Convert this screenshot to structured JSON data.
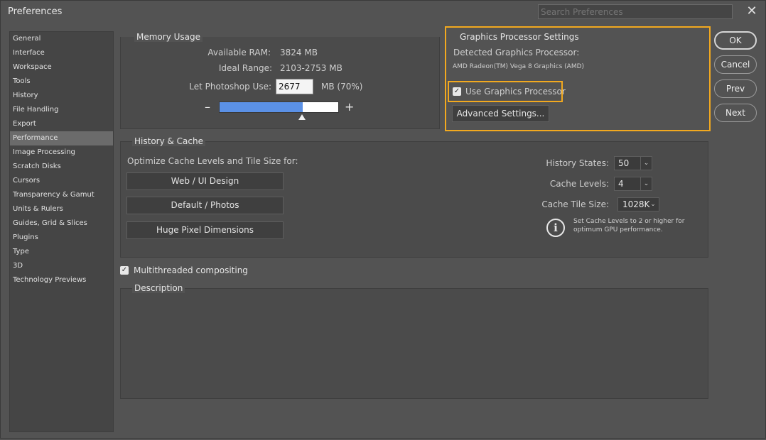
{
  "window": {
    "title": "Preferences",
    "search_placeholder": "Search Preferences",
    "close_glyph": "✕"
  },
  "sidebar": {
    "items": [
      {
        "label": "General"
      },
      {
        "label": "Interface"
      },
      {
        "label": "Workspace"
      },
      {
        "label": "Tools"
      },
      {
        "label": "History"
      },
      {
        "label": "File Handling"
      },
      {
        "label": "Export"
      },
      {
        "label": "Performance"
      },
      {
        "label": "Image Processing"
      },
      {
        "label": "Scratch Disks"
      },
      {
        "label": "Cursors"
      },
      {
        "label": "Transparency & Gamut"
      },
      {
        "label": "Units & Rulers"
      },
      {
        "label": "Guides, Grid & Slices"
      },
      {
        "label": "Plugins"
      },
      {
        "label": "Type"
      },
      {
        "label": "3D"
      },
      {
        "label": "Technology Previews"
      }
    ],
    "selected": "Performance"
  },
  "memory": {
    "title": "Memory Usage",
    "available_label": "Available RAM:",
    "available_value": "3824 MB",
    "ideal_label": "Ideal Range:",
    "ideal_value": "2103-2753 MB",
    "use_label": "Let Photoshop Use:",
    "use_value": "2677",
    "use_unit": "MB (70%)",
    "slider_fraction": 0.7,
    "minus": "–",
    "plus": "+"
  },
  "gpu": {
    "title": "Graphics Processor Settings",
    "detected_label": "Detected Graphics Processor:",
    "detected_value": "AMD Radeon(TM) Vega 8 Graphics (AMD)",
    "use_gpu_label": "Use Graphics Processor",
    "use_gpu_checked": true,
    "advanced_label": "Advanced Settings..."
  },
  "history_cache": {
    "title": "History & Cache",
    "optimize_label": "Optimize Cache Levels and Tile Size for:",
    "buttons": [
      "Web / UI Design",
      "Default / Photos",
      "Huge Pixel Dimensions"
    ],
    "history_states_label": "History States:",
    "history_states_value": "50",
    "cache_levels_label": "Cache Levels:",
    "cache_levels_value": "4",
    "tile_size_label": "Cache Tile Size:",
    "tile_size_value": "1028K",
    "info_text_1": "Set Cache Levels to 2 or higher for",
    "info_text_2": "optimum GPU performance."
  },
  "options": {
    "multithreaded_label": "Multithreaded compositing",
    "multithreaded_checked": true
  },
  "description": {
    "title": "Description"
  },
  "actions": {
    "ok": "OK",
    "cancel": "Cancel",
    "prev": "Prev",
    "next": "Next"
  },
  "colors": {
    "highlight": "#f2a91f",
    "slider_fill": "#5b91e6",
    "background": "#535353"
  },
  "icons": {
    "checkmark": "check-icon",
    "info": "info-icon",
    "caret": "chevron-down-icon",
    "close": "close-icon"
  }
}
